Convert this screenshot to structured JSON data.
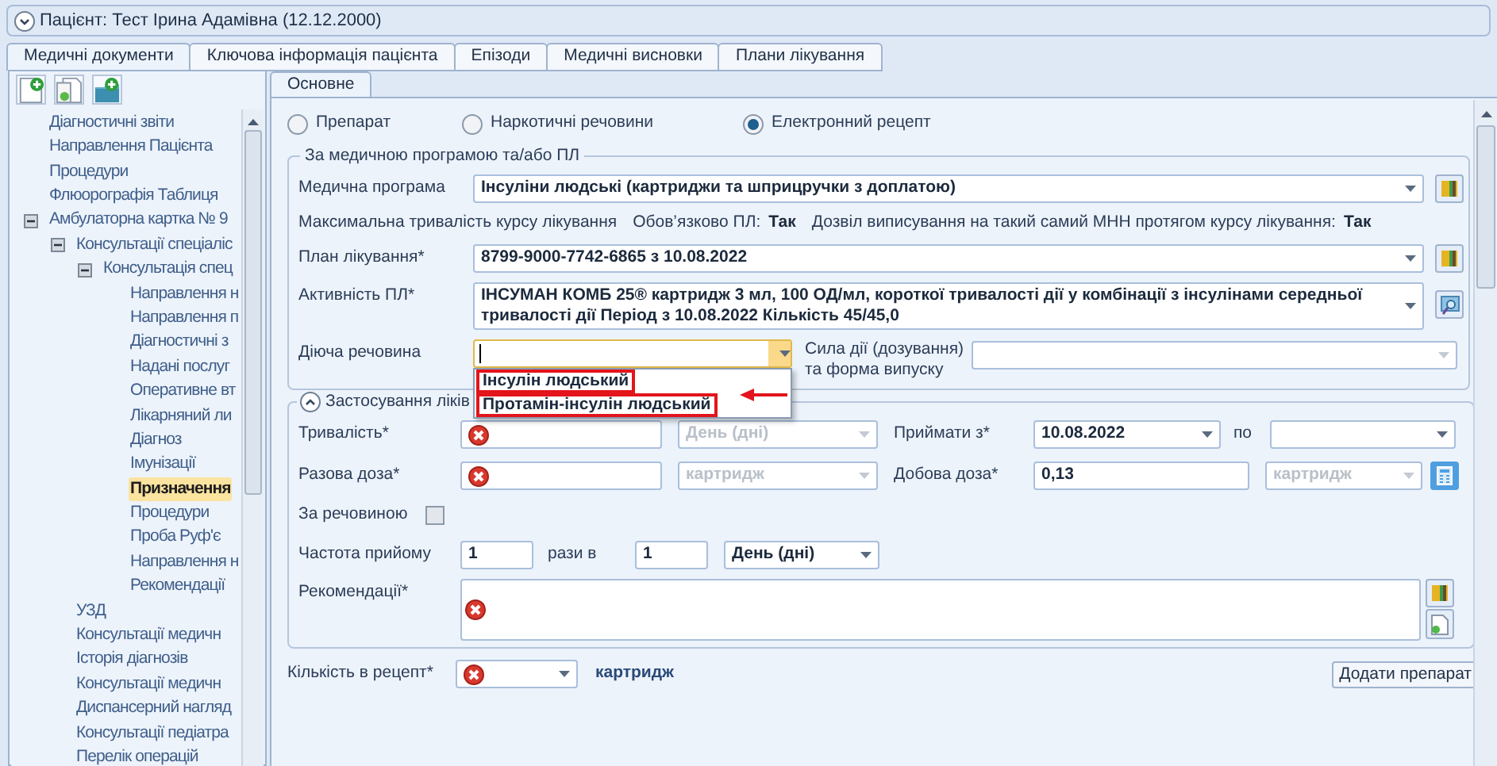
{
  "patient_header": {
    "title": "Пацієнт: Тест Ірина Адамівна (12.12.2000)",
    "expanded": true
  },
  "tabs": [
    {
      "label": "Медичні документи",
      "selected": true
    },
    {
      "label": "Ключова інформація пацієнта",
      "selected": false
    },
    {
      "label": "Епізоди",
      "selected": false
    },
    {
      "label": "Медичні висновки",
      "selected": false
    },
    {
      "label": "Плани лікування",
      "selected": false
    }
  ],
  "tree": [
    {
      "label": "Діагностичні звіти",
      "selected": false
    },
    {
      "label": "Направлення Пацієнта",
      "selected": false
    },
    {
      "label": "Процедури",
      "selected": false
    },
    {
      "label": "Флюорографія Таблиця",
      "selected": false
    },
    {
      "label": "Амбулаторна картка № 9",
      "selected": false,
      "expanded": true,
      "children": [
        {
          "label": "Консультації спеціаліс",
          "selected": false,
          "expanded": true,
          "children": [
            {
              "label": "Консультація спец",
              "selected": false,
              "expanded": true,
              "children": [
                {
                  "label": "Направлення н",
                  "selected": false
                },
                {
                  "label": "Направлення п",
                  "selected": false
                },
                {
                  "label": "Діагностичні з",
                  "selected": false
                },
                {
                  "label": "Надані послуг",
                  "selected": false
                },
                {
                  "label": "Оперативне вт",
                  "selected": false
                },
                {
                  "label": "Лікарняний ли",
                  "selected": false
                },
                {
                  "label": "Діагноз",
                  "selected": false
                },
                {
                  "label": "Імунізації",
                  "selected": false
                },
                {
                  "label": "Призначення",
                  "selected": true
                },
                {
                  "label": "Процедури",
                  "selected": false
                },
                {
                  "label": "Проба Руф'є",
                  "selected": false
                },
                {
                  "label": "Направлення н",
                  "selected": false
                },
                {
                  "label": "Рекомендації",
                  "selected": false
                }
              ]
            }
          ]
        },
        {
          "label": "УЗД",
          "selected": false
        },
        {
          "label": "Консультації медичн",
          "selected": false
        },
        {
          "label": "Історія діагнозів",
          "selected": false
        },
        {
          "label": "Консультації медичн",
          "selected": false
        },
        {
          "label": "Диспансерний нагляд",
          "selected": false
        },
        {
          "label": "Консультації педіатра",
          "selected": false
        },
        {
          "label": "Перелік операцій",
          "selected": false
        }
      ]
    }
  ],
  "subtabs": [
    {
      "label": "Основне",
      "selected": true
    }
  ],
  "prescription_types": [
    {
      "label": "Препарат",
      "selected": false
    },
    {
      "label": "Наркотичні речовини",
      "selected": false
    },
    {
      "label": "Електронний рецепт",
      "selected": true
    }
  ],
  "program_group": {
    "title": "За медичною програмою та/або ПЛ",
    "medical_program": {
      "label": "Медична програма",
      "value": "Інсуліни людські (картриджи та шприцручки з доплатою)"
    },
    "max_duration_label": "Максимальна тривалість курсу лікування",
    "flags": [
      {
        "label": "Обов’язково ПЛ:",
        "value": "Так"
      },
      {
        "label": "Дозвіл виписування на такий самий МНН протягом курсу лікування:",
        "value": "Так"
      }
    ],
    "treatment_plan": {
      "label": "План лікування*",
      "value": "8799-9000-7742-6865 з 10.08.2022"
    },
    "plan_activity": {
      "label": "Активність ПЛ*",
      "value": "ІНСУМАН КОМБ 25® картридж 3 мл, 100 ОД/мл, короткої тривалості дії у комбінації з інсулінами середньої тривалості дії Період з 10.08.2022 Кількість 45/45,0"
    },
    "active_substance": {
      "label": "Діюча речовина",
      "open": true,
      "options": [
        {
          "label": "Інсулін людський",
          "highlighted": true
        },
        {
          "label": "Протамін-інсулін людський",
          "highlighted": true
        }
      ]
    },
    "strength": {
      "label": "Сила дії (дозування) та форма випуску"
    }
  },
  "application_group": {
    "title": "Застосування ліків",
    "expanded": true,
    "duration": {
      "label": "Тривалість*",
      "error": true,
      "unit": {
        "value": "День (дні)",
        "disabled": true
      }
    },
    "start": {
      "label": "Приймати з*",
      "value": "10.08.2022"
    },
    "end": {
      "label": "по"
    },
    "single_dose": {
      "label": "Разова доза*",
      "error": true,
      "unit": {
        "value": "картридж",
        "disabled": true
      }
    },
    "daily_dose": {
      "label": "Добова доза*",
      "value": "0,13",
      "error": false,
      "unit": {
        "value": "картридж",
        "disabled": true
      }
    },
    "by_substance": {
      "label": "За речовиною",
      "checked": false
    },
    "frequency": {
      "label": "Частота прийому",
      "value": "1",
      "times_label": "рази в",
      "period": "1",
      "period_unit": {
        "value": "День (дні)",
        "disabled": false
      }
    },
    "recommendations": {
      "label": "Рекомендації*",
      "error": true
    }
  },
  "quantity": {
    "label": "Кількість в рецепт*",
    "error": true,
    "unit": "картридж"
  },
  "add_button": "Додати препарат"
}
